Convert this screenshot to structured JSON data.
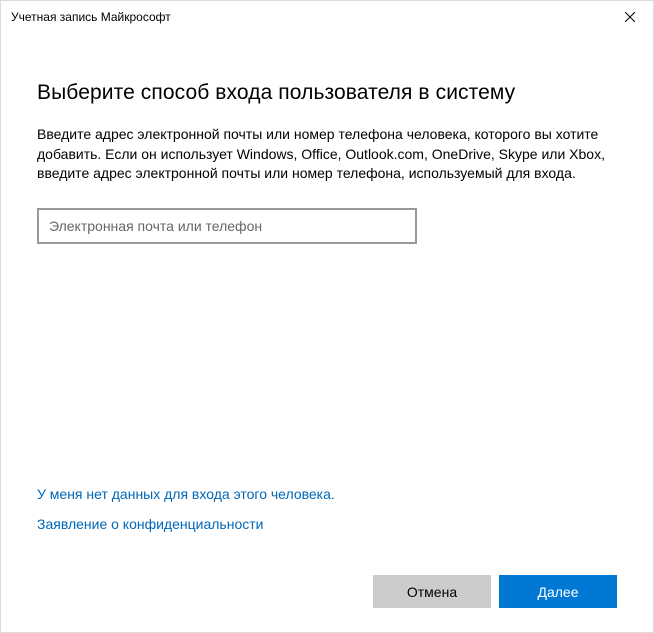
{
  "titlebar": {
    "title": "Учетная запись Майкрософт"
  },
  "main": {
    "heading": "Выберите способ входа пользователя в систему",
    "description": "Введите адрес электронной почты или номер телефона человека, которого вы хотите добавить. Если он использует Windows, Office, Outlook.com, OneDrive, Skype или Xbox, введите адрес электронной почты или номер телефона, используемый для входа.",
    "input_placeholder": "Электронная почта или телефон",
    "input_value": ""
  },
  "links": {
    "no_signin_info": "У меня нет данных для входа этого человека.",
    "privacy": "Заявление о конфиденциальности"
  },
  "buttons": {
    "cancel": "Отмена",
    "next": "Далее"
  }
}
